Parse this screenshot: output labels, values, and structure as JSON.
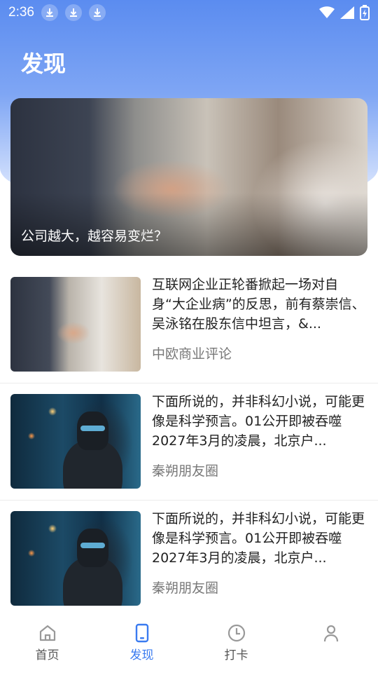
{
  "status_bar": {
    "time": "2:36"
  },
  "header": {
    "title": "发现"
  },
  "banner": {
    "caption": "公司越大，越容易变烂？"
  },
  "articles": [
    {
      "text": "互联网企业正轮番掀起一场对自身“大企业病”的反思，前有蔡崇信、吴泳铭在股东信中坦言，&...",
      "source": "中欧商业评论",
      "thumb": "handshake-image"
    },
    {
      "text": "下面所说的，并非科幻小说，可能更像是科学预言。01公开即被吞噬2027年3月的凌晨，北京户...",
      "source": "秦朔朋友圈",
      "thumb": "robot-image"
    },
    {
      "text": "下面所说的，并非科幻小说，可能更像是科学预言。01公开即被吞噬2027年3月的凌晨，北京户...",
      "source": "秦朔朋友圈",
      "thumb": "robot-image"
    }
  ],
  "tabbar": {
    "active_color": "#3a7bf0",
    "items": [
      {
        "label": "首页",
        "icon": "home-icon"
      },
      {
        "label": "发现",
        "icon": "phone-icon"
      },
      {
        "label": "打卡",
        "icon": "clock-icon"
      },
      {
        "label": "",
        "icon": "person-icon"
      }
    ]
  }
}
